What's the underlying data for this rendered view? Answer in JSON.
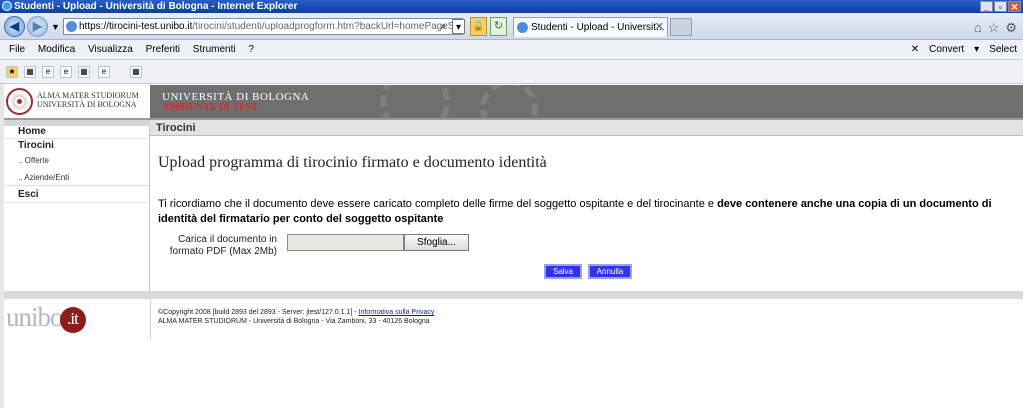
{
  "window": {
    "title": "Studenti - Upload - Università di Bologna - Internet Explorer",
    "buttons": [
      "_",
      "▫",
      "✕"
    ]
  },
  "address_bar": {
    "url_host": "https://tirocini-test.unibo.it",
    "url_path": "/tirocini/studenti/uploadprogform.htm?backUrl=homePageStudent"
  },
  "tab": {
    "label": "Studenti - Upload - Universit...",
    "close": "✕"
  },
  "menu": {
    "items": [
      "File",
      "Modifica",
      "Visualizza",
      "Preferiti",
      "Strumenti",
      "?"
    ],
    "right": [
      "✕",
      "Convert",
      "▾",
      "Select"
    ]
  },
  "header": {
    "alma_line1": "ALMA MATER STUDIORUM",
    "alma_line2": "UNIVERSITÀ DI BOLOGNA",
    "university": "UNIVERSITÀ DI BOLOGNA",
    "environment": "AMBIENTE DI TEST"
  },
  "sidebar": {
    "items": [
      {
        "label": "Home"
      },
      {
        "label": "Tirocini"
      },
      {
        "label": ".. Offerte"
      },
      {
        "label": ".. Aziende/Enti"
      },
      {
        "label": "Esci"
      }
    ]
  },
  "section": {
    "title": "Tirocini"
  },
  "main": {
    "title": "Upload programma di tirocinio firmato e documento identità",
    "text_normal": "Ti ricordiamo che il documento deve essere caricato completo delle firme del soggetto ospitante e del tirocinante e ",
    "text_bold": "deve contenere anche una copia di un documento di identità del firmatario per conto del soggetto ospitante",
    "file_label_line1": "Carica il documento in",
    "file_label_line2": "formato PDF (Max 2Mb)",
    "browse_label": "Sfoglia...",
    "save_label": "Salva",
    "cancel_label": "Annulla"
  },
  "footer": {
    "logo_text": "unibo",
    "logo_suffix": ".it",
    "copyright": "©Copyright 2008 [build 2893 del 2893 - Server: jtest/127.0.1.1] - ",
    "privacy_link": "Informativa sulla Privacy",
    "address": "ALMA MATER STUDIORUM - Università di Bologna - Via Zamboni, 33 - 40126 Bologna"
  },
  "colors": {
    "header_band": "#6f6f6f",
    "environment": "#d22b2b",
    "button_blue": "#3232e6",
    "logo_red": "#8e1c1c"
  }
}
